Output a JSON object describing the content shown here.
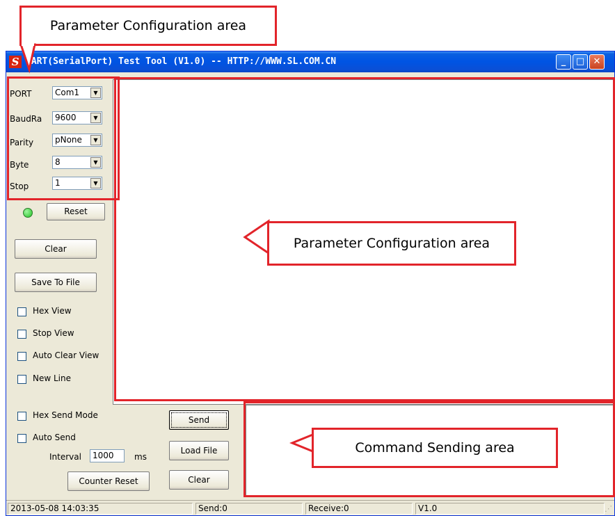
{
  "window": {
    "title": "UART(SerialPort) Test Tool (V1.0) -- HTTP://WWW.SL.COM.CN",
    "app_icon": "S",
    "minimize_glyph": "_",
    "maximize_glyph": "□",
    "close_glyph": "✕"
  },
  "config": {
    "port_label": "PORT",
    "port_value": "Com1",
    "baud_label": "BaudRa",
    "baud_value": "9600",
    "parity_label": "Parity",
    "parity_value": "pNone",
    "byte_label": "Byte",
    "byte_value": "8",
    "stop_label": "Stop",
    "stop_value": "1",
    "dropdown_arrow": "▼"
  },
  "controls": {
    "status_led_color": "#22c322",
    "reset_label": "Reset",
    "clear_label": "Clear",
    "save_label": "Save To File",
    "hex_view_label": "Hex View",
    "stop_view_label": "Stop View",
    "auto_clear_label": "Auto Clear View",
    "new_line_label": "New Line"
  },
  "send": {
    "hex_send_label": "Hex Send Mode",
    "auto_send_label": "Auto Send",
    "interval_label": "Interval",
    "interval_value": "1000",
    "interval_unit": "ms",
    "counter_reset_label": "Counter Reset",
    "send_label": "Send",
    "load_file_label": "Load File",
    "clear_label": "Clear"
  },
  "status": {
    "datetime": "2013-05-08 14:03:35",
    "send": "Send:0",
    "receive": "Receive:0",
    "version": "V1.0"
  },
  "annotations": {
    "top_callout": "Parameter Configuration area",
    "receive_callout": "Parameter Configuration area",
    "send_callout": "Command Sending area",
    "accent_color": "#e2242a"
  }
}
